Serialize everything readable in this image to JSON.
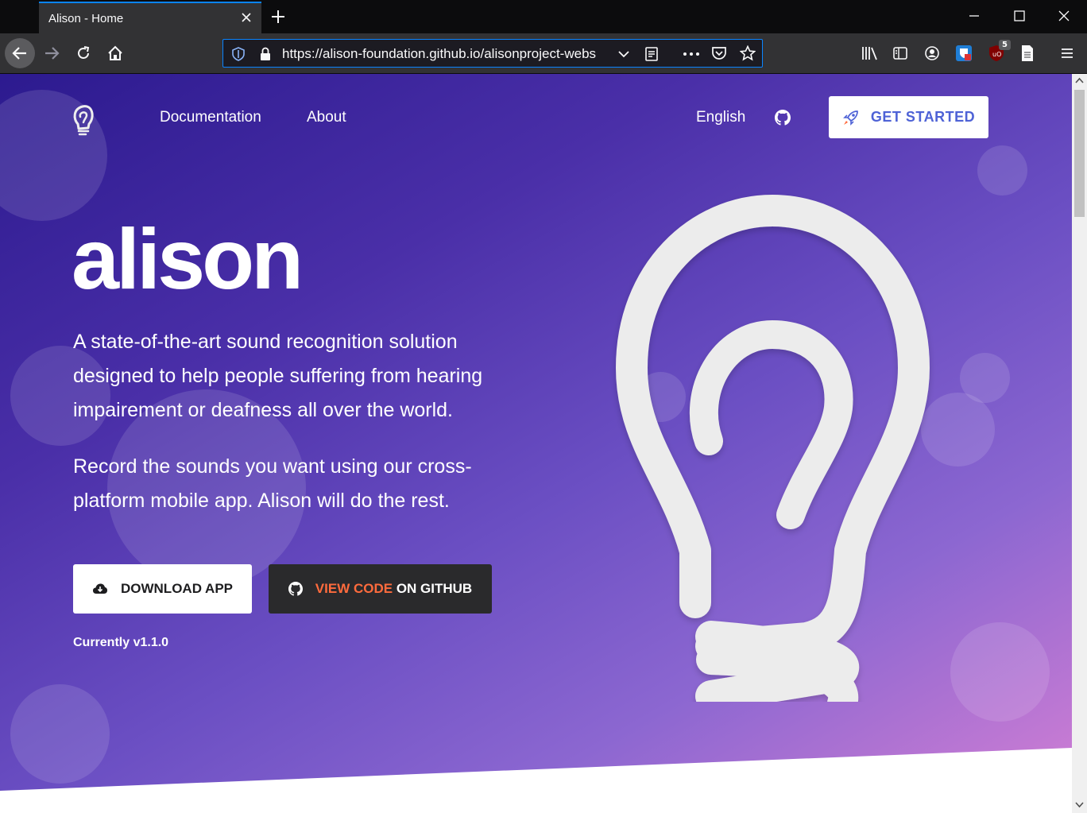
{
  "browser": {
    "tab_title": "Alison - Home",
    "url": "https://alison-foundation.github.io/alisonproject-webs",
    "extension_badge": "5"
  },
  "nav": {
    "documentation": "Documentation",
    "about": "About",
    "language": "English",
    "cta": "GET STARTED"
  },
  "hero": {
    "wordmark": "alison",
    "description": "A state-of-the-art sound recognition solution designed to help people suffering from hearing impairement or deafness all over the world.",
    "instructions": "Record the sounds you want using our cross-platform mobile app. Alison will do the rest.",
    "download_label": "DOWNLOAD APP",
    "github_accent": "VIEW CODE",
    "github_rest": " ON GITHUB",
    "version": "Currently v1.1.0"
  },
  "colors": {
    "accent": "#0a84ff",
    "cta_text": "#4e62d6",
    "github_accent": "#ff6b3d"
  }
}
